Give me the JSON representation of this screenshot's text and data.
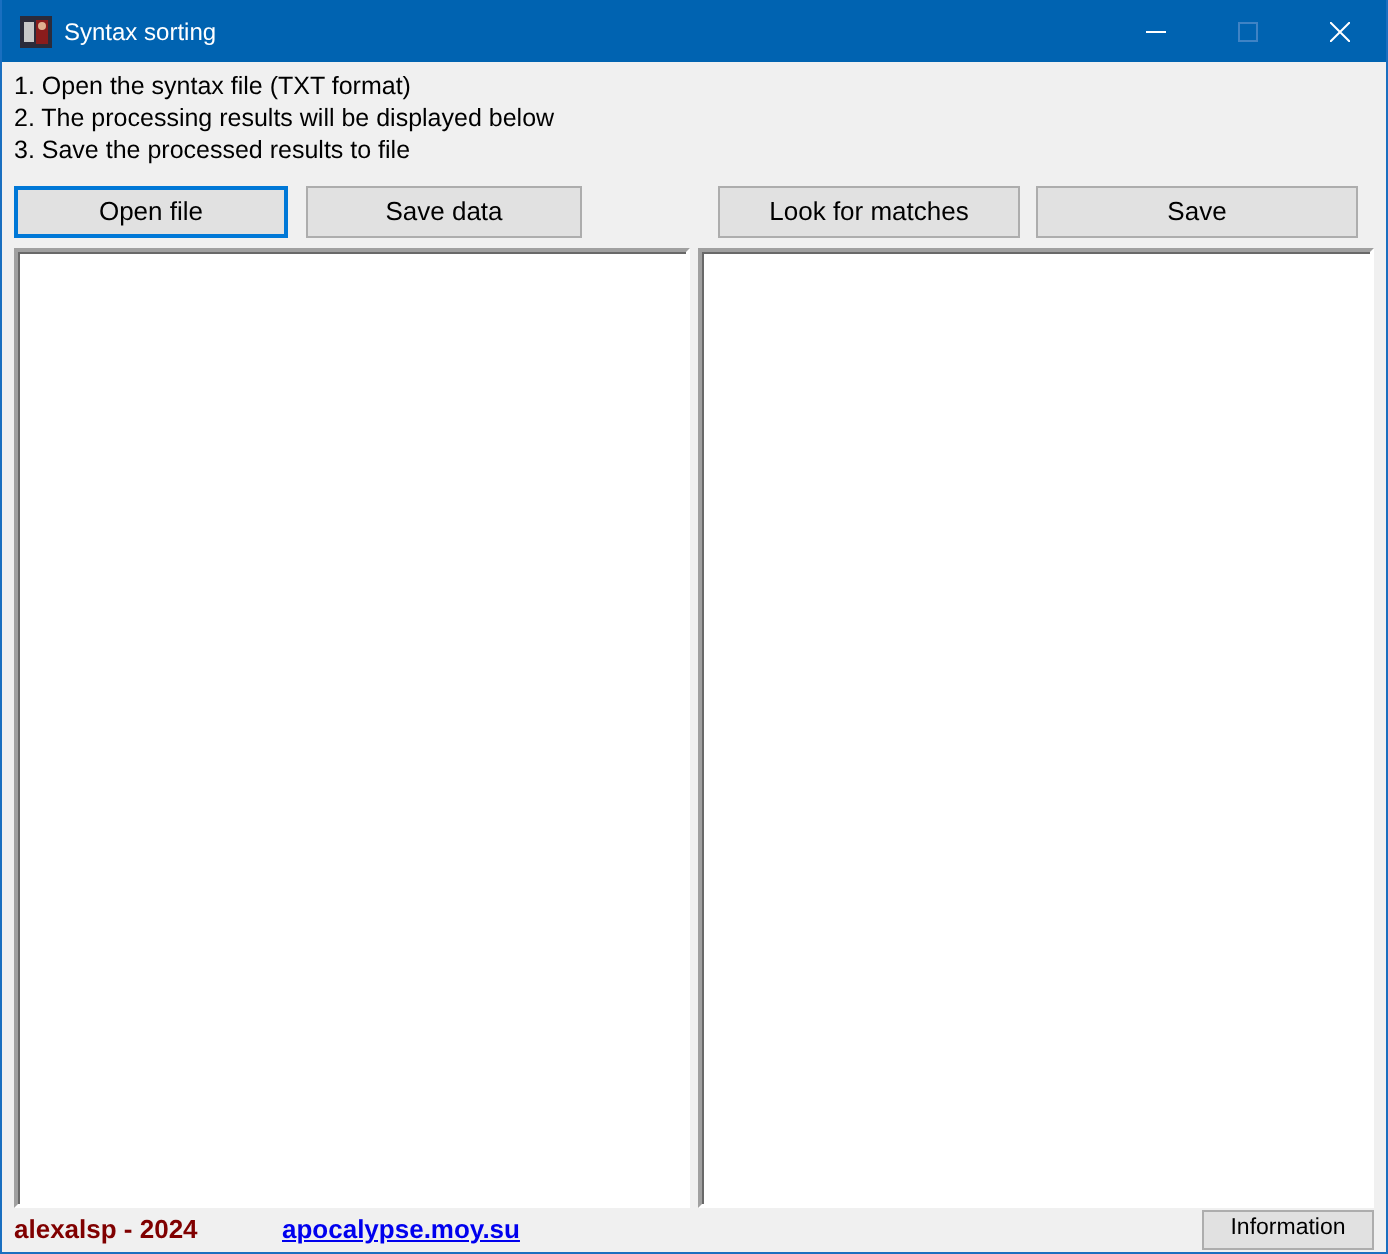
{
  "window": {
    "title": "Syntax sorting",
    "controls": [
      {
        "kind": "minimize",
        "disabled": false
      },
      {
        "kind": "maximize",
        "disabled": true
      },
      {
        "kind": "close",
        "disabled": false
      }
    ]
  },
  "instructions": [
    "1. Open the syntax file (TXT format)",
    "2. The processing results will be displayed below",
    "3. Save the processed results to file"
  ],
  "left_buttons": [
    {
      "label": "Open file",
      "focused": true
    },
    {
      "label": "Save data",
      "focused": false
    }
  ],
  "right_buttons": [
    {
      "label": "Look for matches",
      "focused": false
    },
    {
      "label": "Save",
      "focused": false
    }
  ],
  "footer": {
    "author": "alexalsp - 2024",
    "link": "apocalypse.moy.su",
    "button": "Information"
  }
}
